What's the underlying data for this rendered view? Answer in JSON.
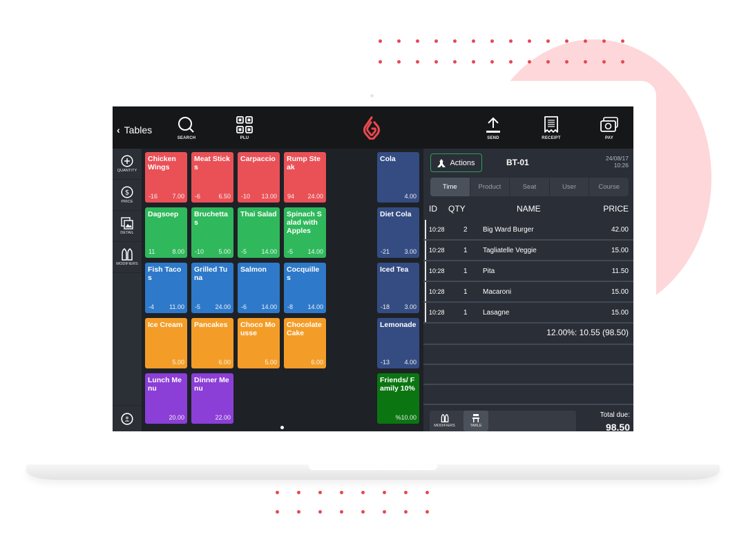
{
  "colors": {
    "red": "#e95157",
    "green": "#2fb85c",
    "blue": "#2e79c9",
    "orange": "#f39d28",
    "purple": "#8b3fd6",
    "navy": "#344c82",
    "dark_green": "#0b7512",
    "accent": "#e8474f"
  },
  "topbar": {
    "back_label": "Tables",
    "back_icon": "chevron-left-icon",
    "buttons": [
      {
        "label": "SEARCH",
        "icon": "search-icon"
      },
      {
        "label": "PLU",
        "icon": "grid-icon"
      },
      {
        "label": "SEND",
        "icon": "upload-icon"
      },
      {
        "label": "RECEIPT",
        "icon": "receipt-icon"
      },
      {
        "label": "PAY",
        "icon": "cash-icon"
      }
    ],
    "logo": "flame-logo-icon"
  },
  "leftbar": {
    "items": [
      {
        "label": "QUANTITY",
        "icon": "plus-circle-icon"
      },
      {
        "label": "PRICE",
        "icon": "dollar-circle-icon"
      },
      {
        "label": "DETAIL",
        "icon": "image-stack-icon"
      },
      {
        "label": "MODIFIERS",
        "icon": "modifiers-icon"
      }
    ],
    "bottom_icon": "user-circle-icon"
  },
  "products": [
    {
      "name": "Chicken Wings",
      "stock": "-16",
      "price": "7.00",
      "color": "red"
    },
    {
      "name": "Meat Sticks",
      "stock": "-6",
      "price": "6.50",
      "color": "red"
    },
    {
      "name": "Carpaccio",
      "stock": "-10",
      "price": "13.00",
      "color": "red"
    },
    {
      "name": "Rump Steak",
      "stock": "94",
      "price": "24.00",
      "color": "red"
    },
    {
      "name": "Dagsoep",
      "stock": "11",
      "price": "8.00",
      "color": "green"
    },
    {
      "name": "Bruchettas",
      "stock": "-10",
      "price": "5.00",
      "color": "green"
    },
    {
      "name": "Thai Salad",
      "stock": "-5",
      "price": "14.00",
      "color": "green"
    },
    {
      "name": "Spinach Salad with Apples",
      "stock": "-5",
      "price": "14.00",
      "color": "green"
    },
    {
      "name": "Fish Tacos",
      "stock": "-4",
      "price": "11.00",
      "color": "blue"
    },
    {
      "name": "Grilled Tuna",
      "stock": "-5",
      "price": "24.00",
      "color": "blue"
    },
    {
      "name": "Salmon",
      "stock": "-6",
      "price": "14.00",
      "color": "blue"
    },
    {
      "name": "Cocquilles",
      "stock": "-8",
      "price": "14.00",
      "color": "blue"
    },
    {
      "name": "Ice Cream",
      "stock": "",
      "price": "5.00",
      "color": "orange"
    },
    {
      "name": "Pancakes",
      "stock": "",
      "price": "6.00",
      "color": "orange"
    },
    {
      "name": "Choco Mousse",
      "stock": "",
      "price": "5.00",
      "color": "orange"
    },
    {
      "name": "Chocolate Cake",
      "stock": "",
      "price": "6.00",
      "color": "orange"
    },
    {
      "name": "Lunch Menu",
      "stock": "",
      "price": "20.00",
      "color": "purple"
    },
    {
      "name": "Dinner Menu",
      "stock": "",
      "price": "22.00",
      "color": "purple"
    }
  ],
  "drinks": [
    {
      "name": "Cola",
      "stock": "",
      "price": "4.00",
      "color": "navy"
    },
    {
      "name": "Diet Cola",
      "stock": "-21",
      "price": "3.00",
      "color": "navy"
    },
    {
      "name": "Iced Tea",
      "stock": "-18",
      "price": "3.00",
      "color": "navy"
    },
    {
      "name": "Lemonade",
      "stock": "-13",
      "price": "4.00",
      "color": "navy"
    },
    {
      "name": "Friends/ Family 10%",
      "stock": "",
      "price": "%10.00",
      "color": "dark_green"
    }
  ],
  "order": {
    "actions_label": "Actions",
    "actions_icon": "actions-icon",
    "table_id": "BT-01",
    "date": "24/08/17",
    "time": "10:26",
    "sort_tabs": [
      "Time",
      "Product",
      "Seat",
      "User",
      "Course"
    ],
    "active_tab": "Time",
    "columns": {
      "id": "ID",
      "qty": "QTY",
      "name": "NAME",
      "price": "PRICE"
    },
    "items": [
      {
        "time": "10:28",
        "qty": "2",
        "name": "Big Ward Burger",
        "price": "42.00"
      },
      {
        "time": "10:28",
        "qty": "1",
        "name": "Tagliatelle Veggie",
        "price": "15.00"
      },
      {
        "time": "10:28",
        "qty": "1",
        "name": "Pita",
        "price": "11.50"
      },
      {
        "time": "10:28",
        "qty": "1",
        "name": "Macaroni",
        "price": "15.00"
      },
      {
        "time": "10:28",
        "qty": "1",
        "name": "Lasagne",
        "price": "15.00"
      }
    ],
    "tax_line": "12.00%: 10.55 (98.50)",
    "tools": [
      {
        "label": "MODIFIERS",
        "icon": "modifiers-icon"
      },
      {
        "label": "TABLE",
        "icon": "table-chair-icon"
      }
    ],
    "total_label": "Total due:",
    "total_value": "98.50"
  }
}
